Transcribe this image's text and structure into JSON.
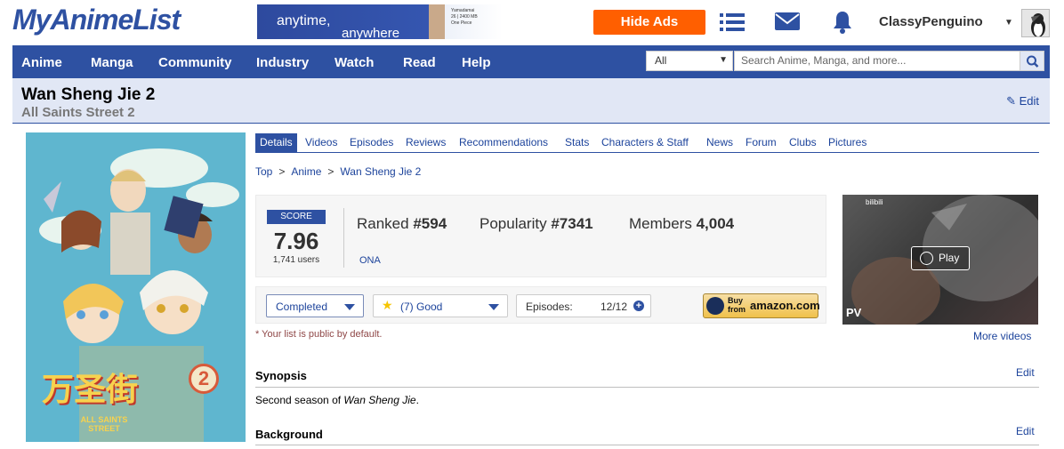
{
  "header": {
    "logo": "MyAnimeList",
    "ad": {
      "line1": "anytime,",
      "line2": "anywhere",
      "mini1": "Yamadamai",
      "mini2": "26 | 2400 MB",
      "mini3": "One Piece"
    },
    "hide_ads": "Hide Ads",
    "icons": [
      "list-icon",
      "mail-icon",
      "bell-icon"
    ],
    "username": "ClassyPenguino"
  },
  "nav": {
    "items": [
      "Anime",
      "Manga",
      "Community",
      "Industry",
      "Watch",
      "Read",
      "Help"
    ],
    "search_scope": "All",
    "search_placeholder": "Search Anime, Manga, and more..."
  },
  "title": {
    "main": "Wan Sheng Jie 2",
    "english": "All Saints Street 2",
    "edit": "Edit"
  },
  "tabs": [
    "Details",
    "Videos",
    "Episodes",
    "Reviews",
    "Recommendations",
    "Stats",
    "Characters & Staff",
    "News",
    "Forum",
    "Clubs",
    "Pictures"
  ],
  "breadcrumb": [
    "Top",
    "Anime",
    "Wan Sheng Jie 2"
  ],
  "score": {
    "label": "SCORE",
    "value": "7.96",
    "users": "1,741 users",
    "ranked_label": "Ranked",
    "ranked": "#594",
    "popularity_label": "Popularity",
    "popularity": "#7341",
    "members_label": "Members",
    "members": "4,004",
    "type": "ONA"
  },
  "user_list": {
    "status": "Completed",
    "rating": "(7) Good",
    "episodes_label": "Episodes:",
    "episodes": "12/12",
    "amazon_buy": "Buy from",
    "amazon_logo": "amazon.com",
    "public_note": "* Your list is public by default."
  },
  "trailer": {
    "play": "Play",
    "label": "PV",
    "watermark": "bilibili",
    "more_videos": "More videos"
  },
  "synopsis": {
    "heading": "Synopsis",
    "edit": "Edit",
    "text_prefix": "Second season of ",
    "text_title": "Wan Sheng Jie",
    "text_suffix": "."
  },
  "background": {
    "heading": "Background",
    "edit": "Edit"
  },
  "cover": {
    "title_art": "万圣街",
    "subtitle_art": "ALL SAINTS STREET",
    "season_number": "2"
  }
}
